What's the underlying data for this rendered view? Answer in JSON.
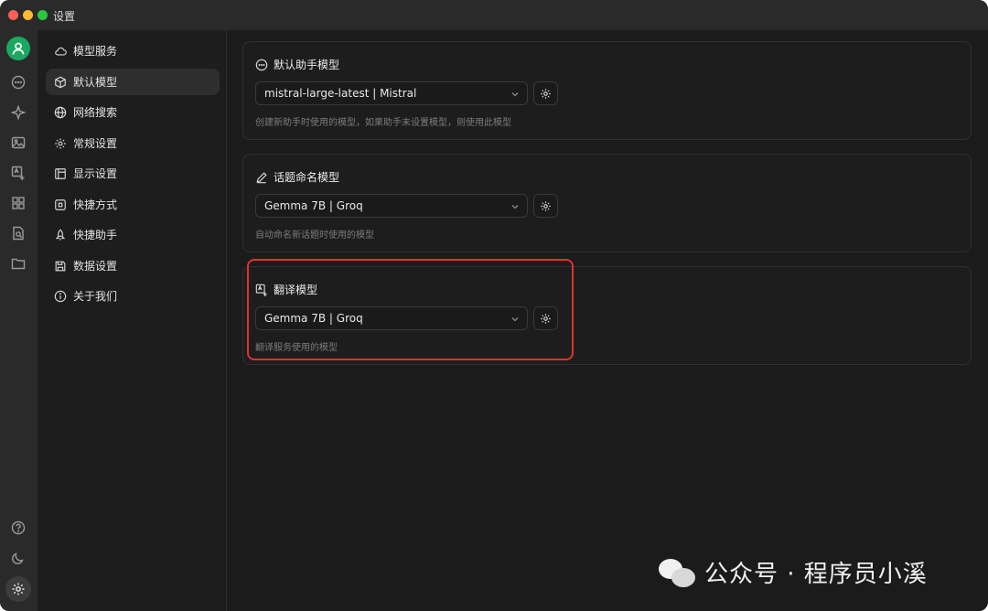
{
  "window": {
    "title": "设置"
  },
  "sidebar": {
    "items": [
      {
        "label": "模型服务",
        "icon": "cloud-icon"
      },
      {
        "label": "默认模型",
        "icon": "cube-icon",
        "active": true
      },
      {
        "label": "网络搜索",
        "icon": "globe-icon"
      },
      {
        "label": "常规设置",
        "icon": "gear-icon"
      },
      {
        "label": "显示设置",
        "icon": "layout-icon"
      },
      {
        "label": "快捷方式",
        "icon": "command-icon"
      },
      {
        "label": "快捷助手",
        "icon": "rocket-icon"
      },
      {
        "label": "数据设置",
        "icon": "save-icon"
      },
      {
        "label": "关于我们",
        "icon": "info-icon"
      }
    ]
  },
  "cards": [
    {
      "title": "默认助手模型",
      "icon": "chat-icon",
      "selected": "mistral-large-latest | Mistral",
      "hint": "创建新助手时使用的模型，如果助手未设置模型，则使用此模型"
    },
    {
      "title": "话题命名模型",
      "icon": "pencil-icon",
      "selected": "Gemma 7B | Groq",
      "hint": "自动命名新话题时使用的模型"
    },
    {
      "title": "翻译模型",
      "icon": "translate-icon",
      "selected": "Gemma 7B | Groq",
      "hint": "翻译服务使用的模型"
    }
  ],
  "watermark": {
    "text": "公众号 · 程序员小溪"
  },
  "colors": {
    "highlight": "#e0322b",
    "avatar": "#1aa861"
  }
}
